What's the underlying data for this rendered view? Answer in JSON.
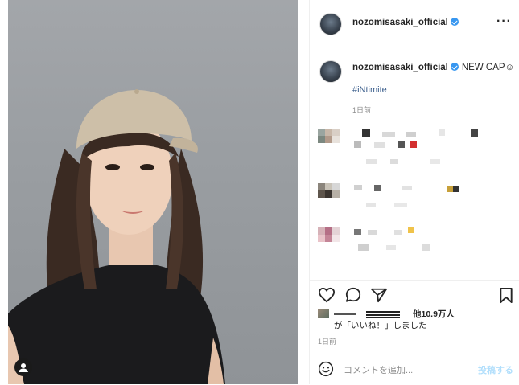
{
  "post": {
    "username": "nozomisasaki_official",
    "caption": "NEW CAP☺",
    "hashtag": "#iNtimite",
    "caption_time": "1日前"
  },
  "likes": {
    "count_text": "他10.9万人",
    "suffix_text": "が「いいね！」しました",
    "time": "1日前"
  },
  "comment_box": {
    "placeholder": "コメントを追加...",
    "post_label": "投稿する"
  },
  "icons": [
    "more-icon",
    "verified-icon",
    "heart-icon",
    "comment-icon",
    "share-icon",
    "bookmark-icon",
    "emoji-icon",
    "user-tag-icon"
  ],
  "colors": {
    "accent": "#3897f0",
    "hashtag": "#3b5e8c",
    "muted": "#8e8e8e",
    "post_disabled": "#b2dffc"
  }
}
